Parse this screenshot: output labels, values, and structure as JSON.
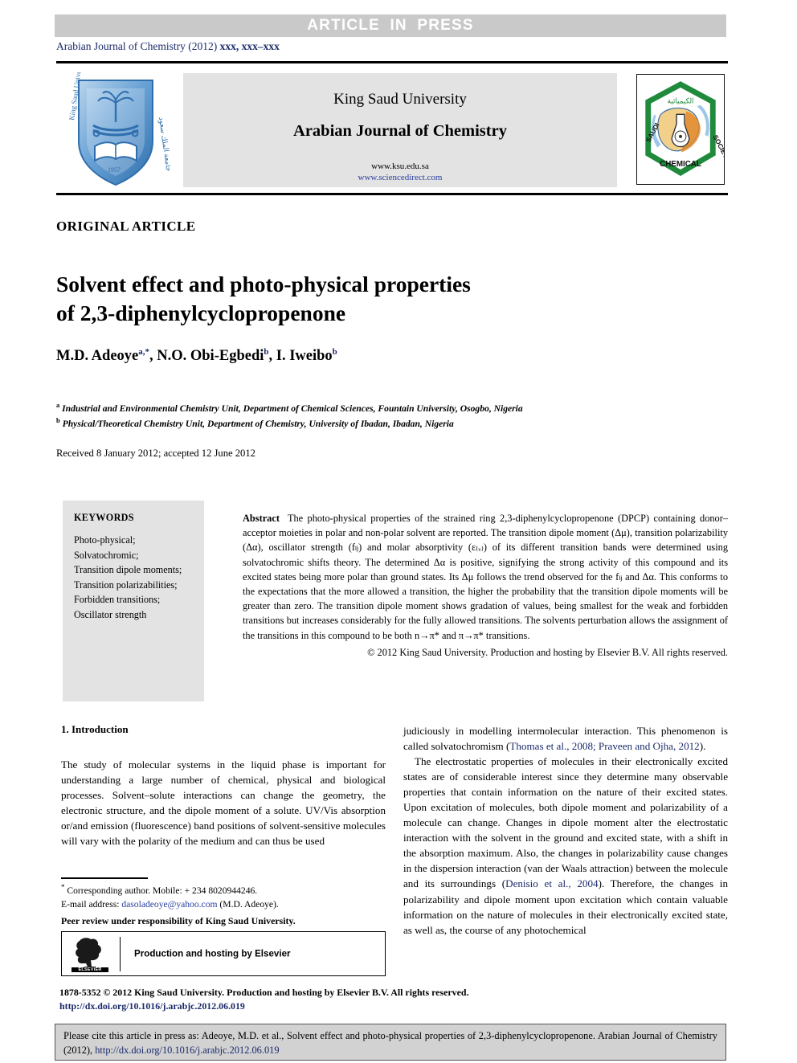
{
  "banner": {
    "text": "ARTICLE  IN  PRESS"
  },
  "running_head": {
    "prefix": "Arabian Journal of Chemistry (2012) ",
    "volume": "xxx",
    "pages": ", xxx–xxx"
  },
  "masthead": {
    "university": "King Saud University",
    "journal": "Arabian Journal of Chemistry",
    "url_ksu": "www.ksu.edu.sa",
    "url_sciencedirect": "www.sciencedirect.com",
    "ksu_logo_alt": "king-saud-university-shield-logo",
    "scs_logo_alt": "saudi-chemical-society-hexagon-logo"
  },
  "article_type": "ORIGINAL ARTICLE",
  "title_line1": "Solvent effect and photo-physical properties",
  "title_line2": "of 2,3-diphenylcyclopropenone",
  "authors": [
    {
      "name": "M.D. Adeoye",
      "marks": "a,*"
    },
    {
      "name": "N.O. Obi-Egbedi",
      "marks": "b"
    },
    {
      "name": "I. Iweibo",
      "marks": "b"
    }
  ],
  "affiliations": [
    {
      "mark": "a",
      "text": "Industrial and Environmental Chemistry Unit, Department of Chemical Sciences, Fountain University, Osogbo, Nigeria"
    },
    {
      "mark": "b",
      "text": "Physical/Theoretical Chemistry Unit, Department of Chemistry, University of Ibadan, Ibadan, Nigeria"
    }
  ],
  "received": "Received 8 January 2012; accepted 12 June 2012",
  "keywords": {
    "heading": "KEYWORDS",
    "items": [
      "Photo-physical;",
      "Solvatochromic;",
      "Transition dipole moments;",
      "Transition polarizabilities;",
      "Forbidden transitions;",
      "Oscillator strength"
    ]
  },
  "abstract": {
    "label": "Abstract",
    "text": "The photo-physical properties of the strained ring 2,3-diphenylcyclopropenone (DPCP) containing donor–acceptor moieties in polar and non-polar solvent are reported. The transition dipole moment (Δμ), transition polarizability (Δα), oscillator strength (fₗⱼ) and molar absorptivity (ε₍ᵥ₎) of its different transition bands were determined using solvatochromic shifts theory. The determined Δα is positive, signifying the strong activity of this compound and its excited states being more polar than ground states. Its Δμ follows the trend observed for the fₗⱼ and Δα. This conforms to the expectations that the more allowed a transition, the higher the probability that the transition dipole moments will be greater than zero. The transition dipole moment shows gradation of values, being smallest for the weak and forbidden transitions but increases considerably for the fully allowed transitions. The solvents perturbation allows the assignment of the transitions in this compound to be both n→π* and π→π* transitions.",
    "copyright": "© 2012 King Saud University. Production and hosting by Elsevier B.V. All rights reserved."
  },
  "section": {
    "heading": "1. Introduction"
  },
  "body": {
    "left_p1": "The study of molecular systems in the liquid phase is important for understanding a large number of chemical, physical and biological processes. Solvent–solute interactions can change the geometry, the electronic structure, and the dipole moment of a solute. UV/Vis absorption or/and emission (fluorescence) band positions of solvent-sensitive molecules will vary with the polarity of the medium and can thus be used",
    "right_p1_a": "judiciously in modelling intermolecular interaction. This phenomenon is called solvatochromism (",
    "right_p1_cite": "Thomas et al., 2008; Praveen and Ojha, 2012",
    "right_p1_b": ").",
    "right_p2_a": "The electrostatic properties of molecules in their electronically excited states are of considerable interest since they determine many observable properties that contain information on the nature of their excited states. Upon excitation of molecules, both dipole moment and polarizability of a molecule can change. Changes in dipole moment alter the electrostatic interaction with the solvent in the ground and excited state, with a shift in the absorption maximum. Also, the changes in polarizability cause changes in the dispersion interaction (van der Waals attraction) between the molecule and its surroundings (",
    "right_p2_cite": "Denisio et al., 2004",
    "right_p2_b": "). Therefore, the changes in polarizability and dipole moment upon excitation which contain valuable information on the nature of molecules in their electronically excited state, as well as, the course of any photochemical"
  },
  "footnotes": {
    "corresponding": "Corresponding author. Mobile: + 234 8020944246.",
    "email_label": "E-mail address: ",
    "email": "dasoladeoye@yahoo.com",
    "email_suffix": " (M.D. Adeoye).",
    "peer_review": "Peer review under responsibility of King Saud University."
  },
  "elsevier_box": {
    "label": "Production and hosting by Elsevier",
    "wordmark": "ELSEVIER",
    "logo_alt": "elsevier-tree-logo"
  },
  "issn_line": "1878-5352 © 2012 King Saud University. Production and hosting by Elsevier B.V. All rights reserved.",
  "doi_line": "http://dx.doi.org/10.1016/j.arabjc.2012.06.019",
  "citation_box": {
    "text_a": "Please cite this article in press as: Adeoye, M.D. et al., Solvent effect and photo-physical properties of 2,3-diphenylcyclopropenone. Arabian Journal of Chemistry (2012), ",
    "doi": "http://dx.doi.org/10.1016/j.arabjc.2012.06.019"
  },
  "colors": {
    "banner_bg": "#c9c9c9",
    "masthead_bg": "#e3e3e3",
    "link_blue": "#2b3f9e",
    "cite_blue": "#1b2a6b",
    "citation_box_bg": "#d2d2d2"
  }
}
